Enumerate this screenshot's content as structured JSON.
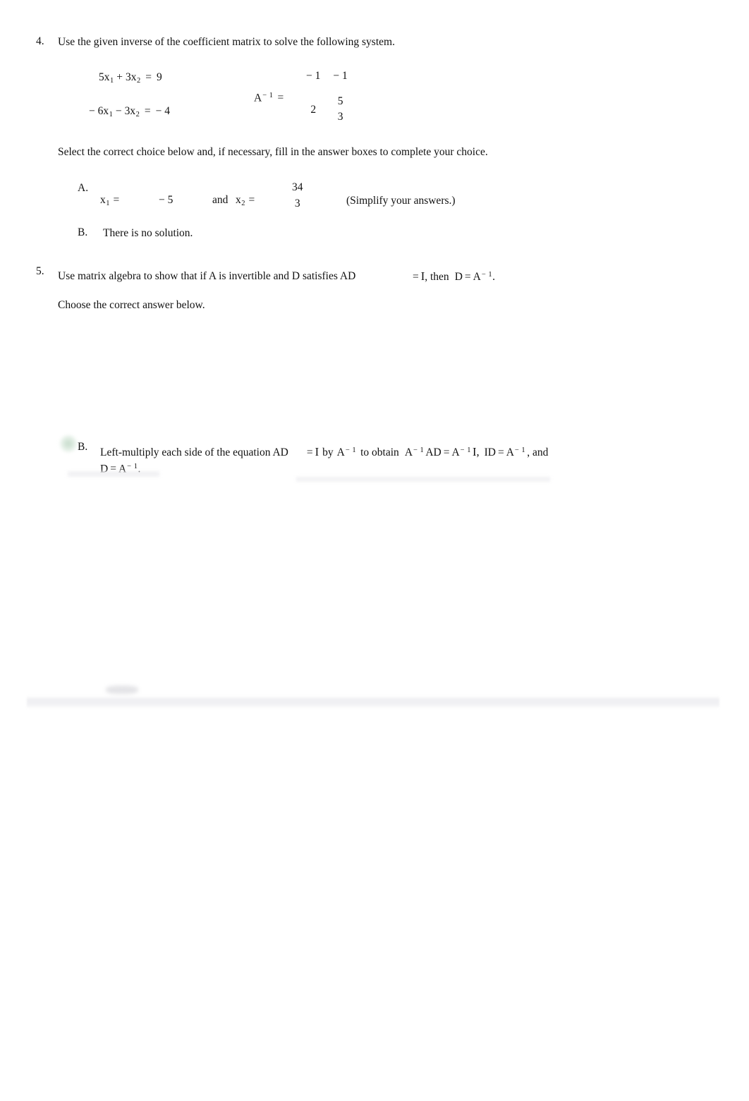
{
  "document": {
    "kind": "math-worksheet-page"
  },
  "questions": [
    {
      "number": "4.",
      "prompt": "Use the given inverse of the coefficient matrix to solve the following system.",
      "system": {
        "eq1": {
          "lhs_a": "5x",
          "sub_a": "1",
          "op": "+",
          "lhs_b": "3x",
          "sub_b": "2",
          "eq": "=",
          "rhs": "9"
        },
        "eq2": {
          "lhs_a": "− 6x",
          "sub_a": "1",
          "op": "−",
          "lhs_b": "3x",
          "sub_b": "2",
          "eq": "=",
          "rhs": "− 4"
        }
      },
      "matrix": {
        "label": "A",
        "label_exponent": "− 1",
        "equals": "=",
        "r1c1": "− 1",
        "r1c2": "− 1",
        "r2c1": "2",
        "r2c2_num": "5",
        "r2c2_den": "3"
      },
      "instruction": "Select the correct choice below and, if necessary, fill in the answer boxes to complete your choice.",
      "choices": [
        {
          "letter": "A.",
          "var1": "x",
          "var1_sub": "1",
          "var1_eq": "=",
          "var1_value": "− 5",
          "conj": "and",
          "var2": "x",
          "var2_sub": "2",
          "var2_eq": "=",
          "var2_value_num": "34",
          "var2_value_den": "3",
          "note": "(Simplify your answers.)"
        },
        {
          "letter": "B.",
          "text": "There is no solution."
        }
      ]
    },
    {
      "number": "5.",
      "prompt_part1": "Use matrix algebra to show that if A is invertible and D satisfies AD",
      "prompt_eq": "=",
      "prompt_I": "I",
      "prompt_part2": ", then",
      "prompt_D": "D",
      "prompt_eq2": "=",
      "prompt_A": "A",
      "prompt_A_exp": "− 1",
      "prompt_period": ".",
      "instruction": "Choose the correct answer below.",
      "choices": [
        {
          "letter": "B.",
          "selected": true,
          "line1_a": "Left-multiply each side of the equation AD",
          "line1_eq": "=",
          "line1_I": "I",
          "line1_by": "by",
          "line1_A": "A",
          "line1_A_exp": "− 1",
          "line1_obtain": "to obtain",
          "line1_t1_A": "A",
          "line1_t1_exp": "− 1",
          "line1_t1_AD": "AD",
          "line1_t1_eq": "=",
          "line1_t2_A": "A",
          "line1_t2_exp": "− 1",
          "line1_t2_I": "I,",
          "line1_t3_ID": "ID",
          "line1_t3_eq": "=",
          "line1_t3_A": "A",
          "line1_t3_exp": "− 1",
          "line1_t3_tail": ", and",
          "line2_D": "D",
          "line2_eq": "=",
          "line2_A": "A",
          "line2_exp": "− 1",
          "line2_period": "."
        }
      ]
    }
  ],
  "colors": {
    "text": "#111111",
    "page_background": "#ffffff",
    "selection_highlight": "#96be a0"
  }
}
